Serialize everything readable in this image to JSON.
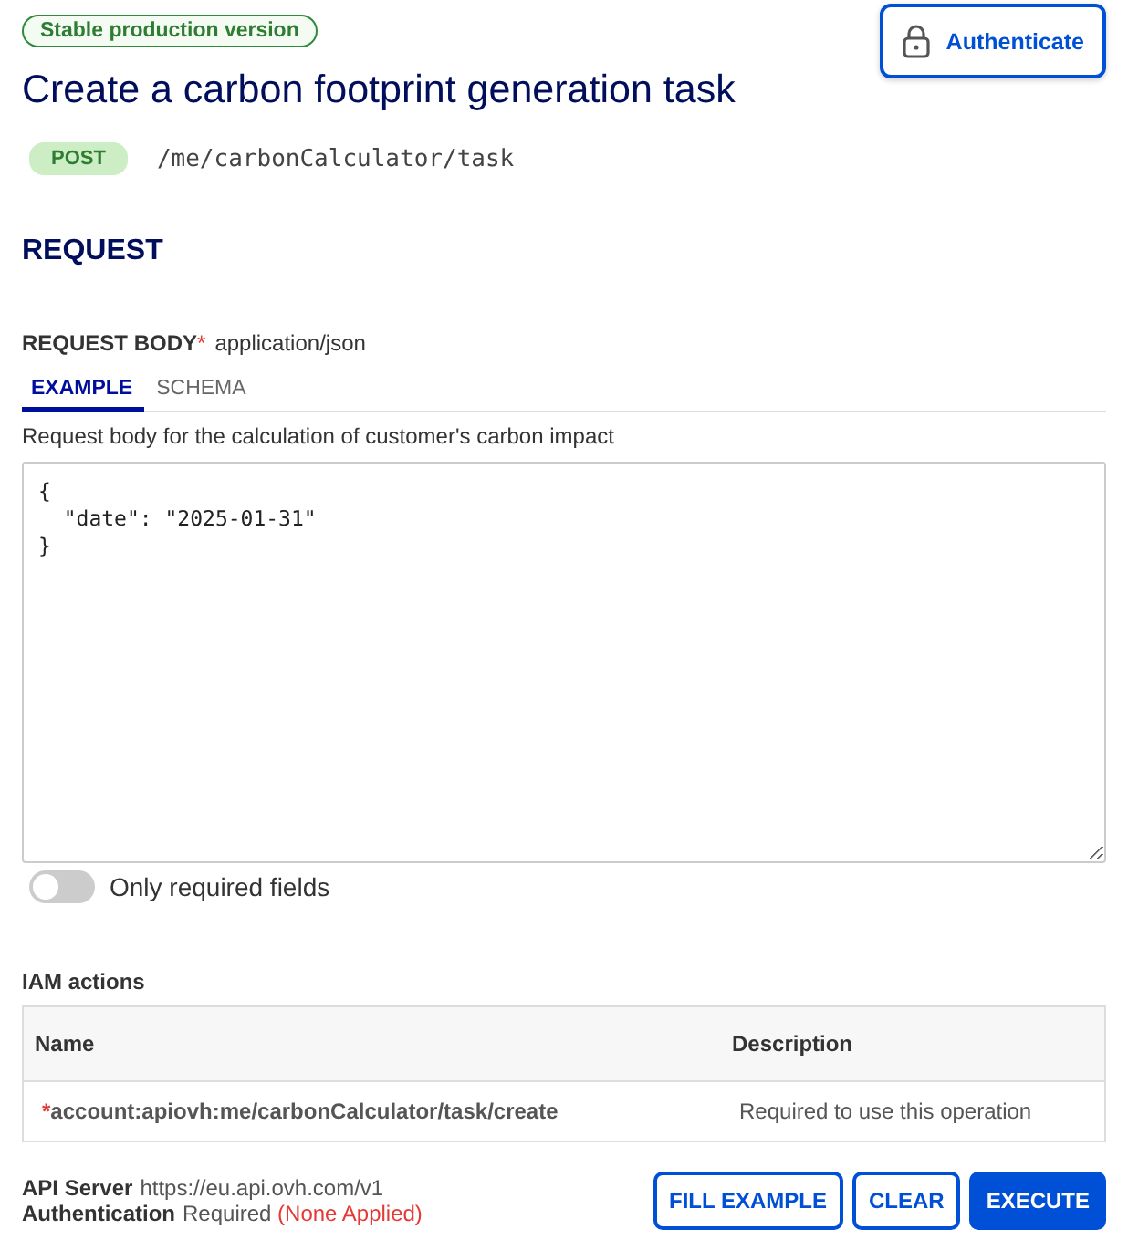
{
  "badge": "Stable production version",
  "auth_button": "Authenticate",
  "title": "Create a carbon footprint generation task",
  "method": "POST",
  "path": "/me/carbonCalculator/task",
  "section": "REQUEST",
  "body": {
    "label": "REQUEST BODY",
    "required_mark": "*",
    "content_type": "application/json"
  },
  "tabs": [
    {
      "label": "EXAMPLE",
      "selected": true
    },
    {
      "label": "SCHEMA",
      "selected": false
    }
  ],
  "description": "Request body for the calculation of customer's carbon impact",
  "editor": {
    "value": "{\n  \"date\": \"2025-01-31\"\n}"
  },
  "toggle": {
    "label": "Only required fields",
    "on": false
  },
  "iam": {
    "title": "IAM actions",
    "columns": [
      "Name",
      "Description"
    ],
    "rows": [
      {
        "mark": "*",
        "name": "account:apiovh:me/carbonCalculator/task/create",
        "description": "Required to use this operation"
      }
    ]
  },
  "server": {
    "label": "API Server",
    "value": "https://eu.api.ovh.com/v1"
  },
  "authentication": {
    "label": "Authentication",
    "value": "Required",
    "status": "(None Applied)"
  },
  "buttons": [
    {
      "label": "FILL EXAMPLE",
      "kind": "outline"
    },
    {
      "label": "CLEAR",
      "kind": "outline"
    },
    {
      "label": "EXECUTE",
      "kind": "primary"
    }
  ]
}
